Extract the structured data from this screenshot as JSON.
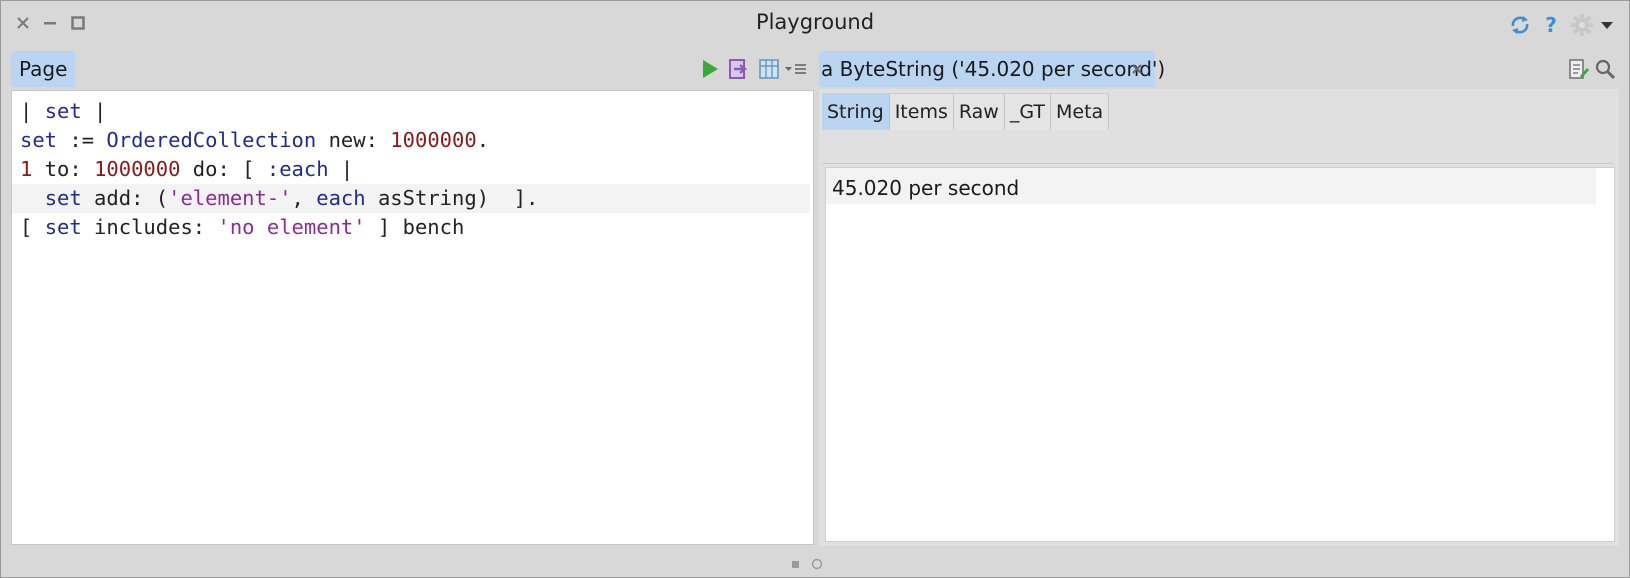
{
  "window": {
    "title": "Playground",
    "controls": [
      "close-icon",
      "minimize-icon",
      "maximize-icon"
    ],
    "top_right_icons": [
      "sync-icon",
      "help-icon",
      "settings-icon",
      "dropdown-arrow-icon"
    ],
    "help_glyph": "?"
  },
  "playground": {
    "tab_label": "Page",
    "toolbar_icons": [
      "run-icon",
      "print-it-icon",
      "bindings-icon",
      "menu-icon"
    ],
    "code_lines": [
      [
        {
          "t": "| ",
          "c": "plain"
        },
        {
          "t": "set",
          "c": "var"
        },
        {
          "t": " |",
          "c": "plain"
        }
      ],
      [
        {
          "t": "set",
          "c": "var"
        },
        {
          "t": " := ",
          "c": "plain"
        },
        {
          "t": "OrderedCollection",
          "c": "cls"
        },
        {
          "t": " new: ",
          "c": "plain"
        },
        {
          "t": "1000000",
          "c": "num"
        },
        {
          "t": ".",
          "c": "plain"
        }
      ],
      [
        {
          "t": "1",
          "c": "num"
        },
        {
          "t": " to: ",
          "c": "plain"
        },
        {
          "t": "1000000",
          "c": "num"
        },
        {
          "t": " do: [ ",
          "c": "plain"
        },
        {
          "t": ":each",
          "c": "var"
        },
        {
          "t": " |",
          "c": "plain"
        }
      ],
      [
        {
          "t": "  ",
          "c": "plain"
        },
        {
          "t": "set",
          "c": "var"
        },
        {
          "t": " add: (",
          "c": "plain"
        },
        {
          "t": "'element-'",
          "c": "str"
        },
        {
          "t": ", ",
          "c": "plain"
        },
        {
          "t": "each",
          "c": "var"
        },
        {
          "t": " asString)  ].",
          "c": "plain"
        }
      ],
      [
        {
          "t": "[ ",
          "c": "plain"
        },
        {
          "t": "set",
          "c": "var"
        },
        {
          "t": " includes: ",
          "c": "plain"
        },
        {
          "t": "'no element'",
          "c": "str"
        },
        {
          "t": " ] bench",
          "c": "plain"
        }
      ]
    ],
    "highlighted_line": 3
  },
  "inspector": {
    "tab_label": "a ByteString ('45.020 per second')",
    "close_glyph": "×",
    "toolbar_icons": [
      "browse-icon",
      "search-icon"
    ],
    "view_tabs": [
      "String",
      "Items",
      "Raw",
      "_GT",
      "Meta"
    ],
    "active_view_tab": 0,
    "string_value": "45.020 per second"
  },
  "colors": {
    "tab_active": "#b9d5f1",
    "code_variable": "#1f2d8f",
    "code_number": "#8c1a1a",
    "code_string": "#8e2a98",
    "run_green": "#3aa83a",
    "icon_purple": "#8a5ab5",
    "icon_blue": "#3a8fd6"
  }
}
